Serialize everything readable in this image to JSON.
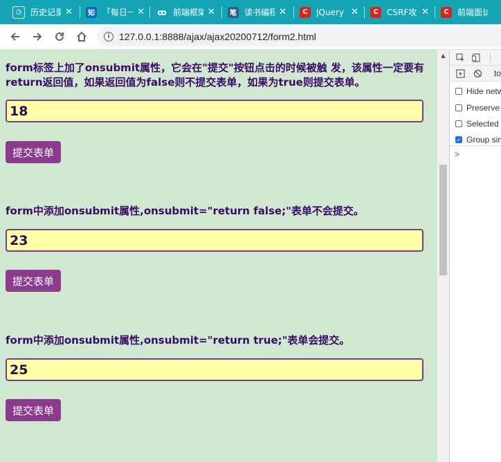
{
  "tabs": [
    {
      "title": "历史记录",
      "icon": "history-icon",
      "icon_text": "◷",
      "icon_bg": "#14a5b5",
      "icon_color": "#fff"
    },
    {
      "title": "「每日一题」",
      "icon": "zhihu-icon",
      "icon_text": "知",
      "icon_bg": "#0a66c2",
      "icon_color": "#fff"
    },
    {
      "title": "前端框架",
      "icon": "code-icon",
      "icon_text": "ꝏ",
      "icon_bg": "#14a5b5",
      "icon_color": "#fff"
    },
    {
      "title": "读书编程笔记",
      "icon": "notes-icon",
      "icon_text": "笔",
      "icon_bg": "#2a5d8a",
      "icon_color": "#fff"
    },
    {
      "title": "JQuery",
      "icon": "csdn-icon",
      "icon_text": "C",
      "icon_bg": "#d7251d",
      "icon_color": "#fff"
    },
    {
      "title": "CSRF攻击",
      "icon": "csdn-icon",
      "icon_text": "C",
      "icon_bg": "#d7251d",
      "icon_color": "#fff"
    },
    {
      "title": "前端面试",
      "icon": "csdn-icon",
      "icon_text": "C",
      "icon_bg": "#d7251d",
      "icon_color": "#fff"
    }
  ],
  "nav": {
    "url": "127.0.0.1:8888/ajax/ajax20200712/form2.html"
  },
  "sections": [
    {
      "text": "form标签上加了onsubmit属性，它会在\"提交\"按钮点击的时候被触 发，该属性一定要有return返回值，如果返回值为false则不提交表单，如果为true则提交表单。",
      "value": "18",
      "button": "提交表单"
    },
    {
      "text": "form中添加onsubmit属性,onsubmit=\"return false;\"表单不会提交。",
      "value": "23",
      "button": "提交表单"
    },
    {
      "text": "form中添加onsubmit属性,onsubmit=\"return true;\"表单会提交。",
      "value": "25",
      "button": "提交表单"
    }
  ],
  "devtools": {
    "toolbar_text": "to",
    "options": [
      {
        "label": "Hide network",
        "checked": false
      },
      {
        "label": "Preserve log",
        "checked": false
      },
      {
        "label": "Selected context only",
        "checked": false
      },
      {
        "label": "Group similar",
        "checked": true
      }
    ],
    "prompt": ">"
  },
  "colors": {
    "tab_bar": "#14a5b5",
    "page_bg": "#cfe8cf",
    "text": "#3a0a6a",
    "input_bg": "#ffffa6",
    "input_border": "#7b3b8a",
    "button_bg": "#8c3a8e"
  }
}
